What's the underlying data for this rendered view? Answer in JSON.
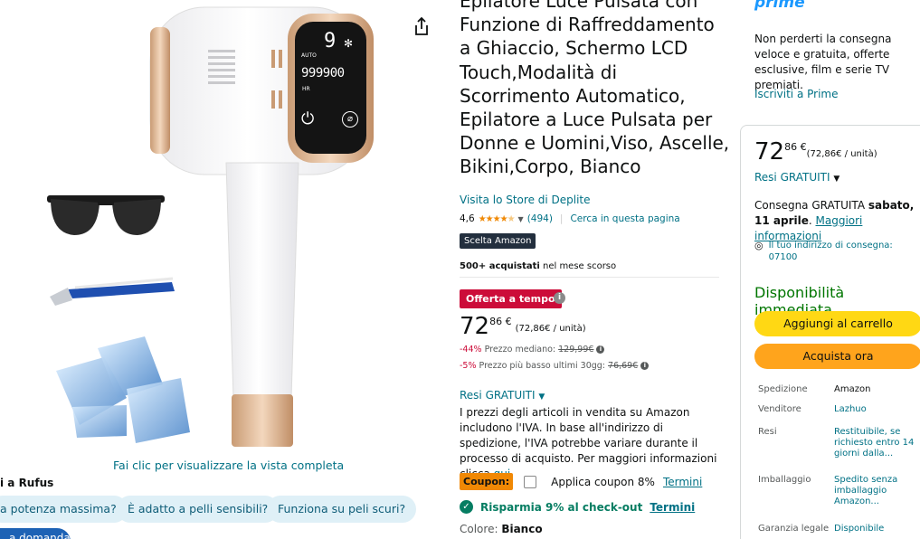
{
  "image_area": {
    "view_full_label": "Fai clic per visualizzare la vista completa",
    "device_screen": {
      "top_value": "9",
      "auto_label": "AUTO",
      "counter": "999900",
      "hr_label": "HR"
    }
  },
  "rufus": {
    "title": "i a Rufus",
    "chips": [
      "a potenza massima?",
      "È adatto a pelli sensibili?",
      "Funziona su peli scuri?"
    ],
    "ask_button": "a domanda"
  },
  "product": {
    "title": "Epilatore Luce Pulsata con Funzione di Raffreddamento a Ghiaccio, Schermo LCD Touch,Modalità di Scorrimento Automatico, Epilatore a Luce Pulsata per Donne e Uomini,Viso, Ascelle, Bikini,Corpo, Bianco",
    "store_link": "Visita lo Store di Deplite",
    "rating": "4,6",
    "rating_stars": 4.6,
    "review_count": "(494)",
    "search_in_page": "Cerca in questa pagina",
    "choice_badge": "Scelta Amazon",
    "bought_bold": "500+ acquistati",
    "bought_rest": " nel mese scorso",
    "deal_badge": "Offerta a tempo",
    "price_int": "72",
    "price_frac": "86 €",
    "price_unit": "(72,86€ / unità)",
    "median_pct": "-44%",
    "median_label": " Prezzo mediano: ",
    "median_price": "129,99€",
    "lowest_pct": "-5%",
    "lowest_label": " Prezzo più basso ultimi 30gg: ",
    "lowest_price": "76,69€",
    "returns_label": "Resi GRATUITI",
    "vat_text": "I prezzi degli articoli in vendita su Amazon includono l'IVA. In base all'indirizzo di spedizione, l'IVA potrebbe variare durante il processo di acquisto. Per maggiori informazioni clicca ",
    "vat_link": "qui",
    "coupon_badge": "Coupon:",
    "coupon_label": "Applica coupon 8%",
    "coupon_terms": "Termini",
    "save_label": "Risparmia 9% al check-out",
    "save_terms": "Termini",
    "color_label": "Colore: ",
    "color_value": "Bianco"
  },
  "prime": {
    "logo": "prime",
    "text": "Non perderti la consegna veloce e gratuita, offerte esclusive, film e serie TV premiati.",
    "signup": "Iscriviti a Prime"
  },
  "buybox": {
    "price_int": "72",
    "price_frac": "86 €",
    "price_unit": "(72,86€ / unità)",
    "returns": "Resi GRATUITI",
    "delivery_prefix": "Consegna GRATUITA ",
    "delivery_date": "sabato, 11 aprile",
    "delivery_link": "Maggiori informazioni",
    "address_line1": "Il tuo indirizzo di consegna:",
    "address_line2": "07100",
    "stock": "Disponibilità immediata",
    "add_to_cart": "Aggiungi al carrello",
    "buy_now": "Acquista ora",
    "info": [
      {
        "key": "Spedizione",
        "value": "Amazon"
      },
      {
        "key": "Venditore",
        "value": "Lazhuo"
      },
      {
        "key": "Resi",
        "value": "Restituibile, se richiesto entro 14 giorni dalla..."
      },
      {
        "key": "Imballaggio",
        "value": "Spedito senza imballaggio Amazon..."
      },
      {
        "key": "Garanzia legale",
        "value": "Disponibile"
      }
    ]
  },
  "colors": {
    "link": "#007185",
    "deal": "#cc0c39",
    "stock": "#007600",
    "cart": "#ffd814",
    "buy": "#ffa41c",
    "prime": "#1a98ff"
  }
}
